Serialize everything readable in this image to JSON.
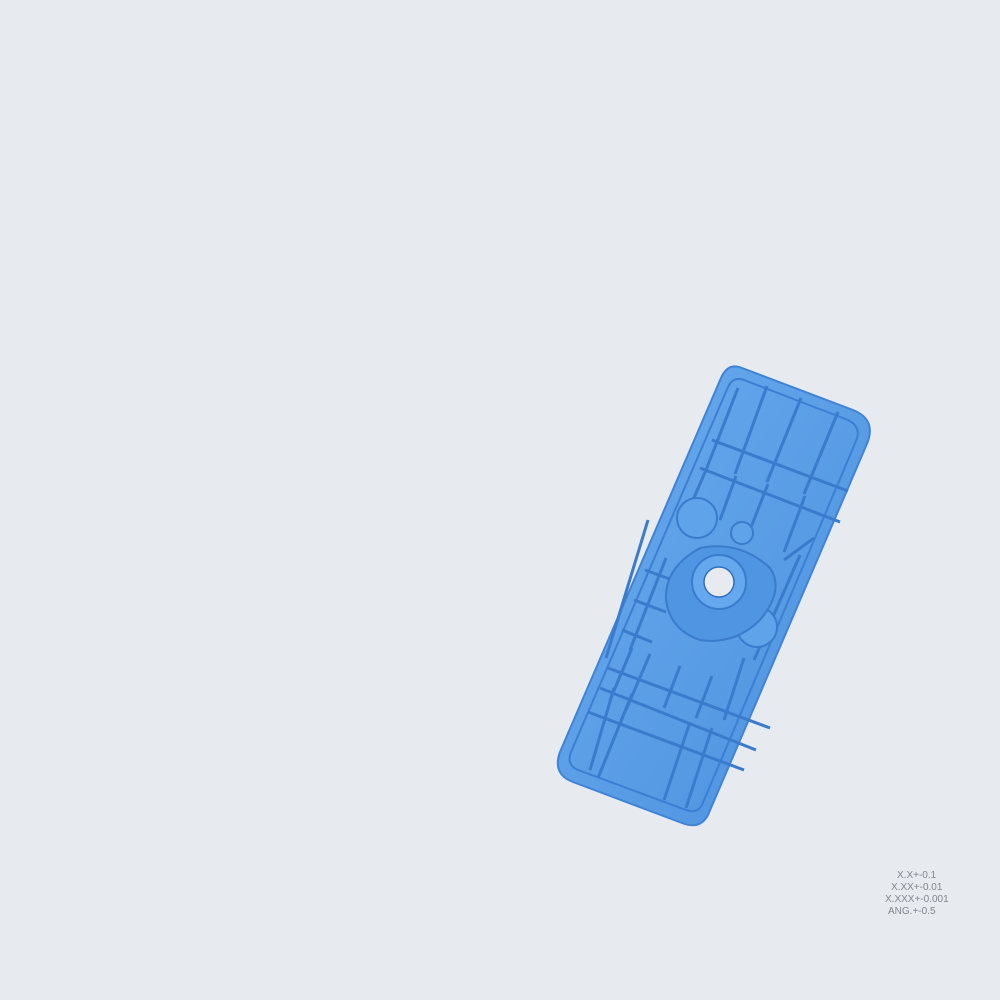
{
  "viewport": {
    "background_color": "#e7eaef",
    "part_color": "#5aa0e6"
  },
  "tolerance_block": {
    "lines": [
      "X.X+-0.1",
      "X.XX+-0.01",
      "X.XXX+-0.001",
      "ANG.+-0.5"
    ]
  }
}
